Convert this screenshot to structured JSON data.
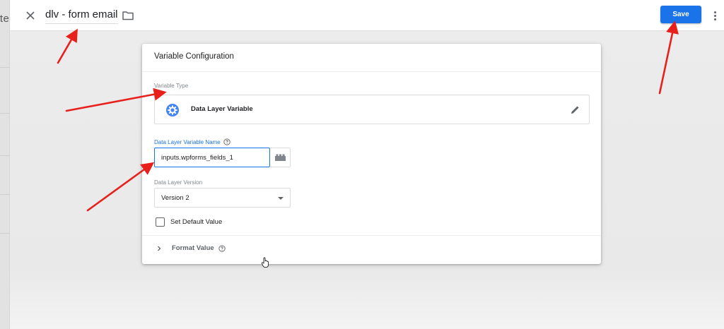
{
  "left_edge": {
    "text": "ite"
  },
  "header": {
    "close_icon": "close-icon",
    "title": "dlv - form email",
    "folder_icon": "folder-icon",
    "save_label": "Save",
    "more_icon": "more-vert-icon"
  },
  "card": {
    "title": "Variable Configuration",
    "variable_type": {
      "section_label": "Variable Type",
      "name": "Data Layer Variable",
      "icon": "gear-badge-icon",
      "edit_icon": "pencil-icon"
    },
    "name_field": {
      "label": "Data Layer Variable Name",
      "value": "inputs.wpforms_fields_1",
      "help_icon": "help-icon",
      "vars_icon": "variable-lego-icon"
    },
    "version_field": {
      "label": "Data Layer Version",
      "selected": "Version 2"
    },
    "default_value": {
      "label": "Set Default Value",
      "checked": false
    },
    "format_value": {
      "label": "Format Value",
      "expanded": false
    }
  },
  "colors": {
    "accent": "#1a73e8",
    "annotation_arrow": "#e8201c"
  }
}
